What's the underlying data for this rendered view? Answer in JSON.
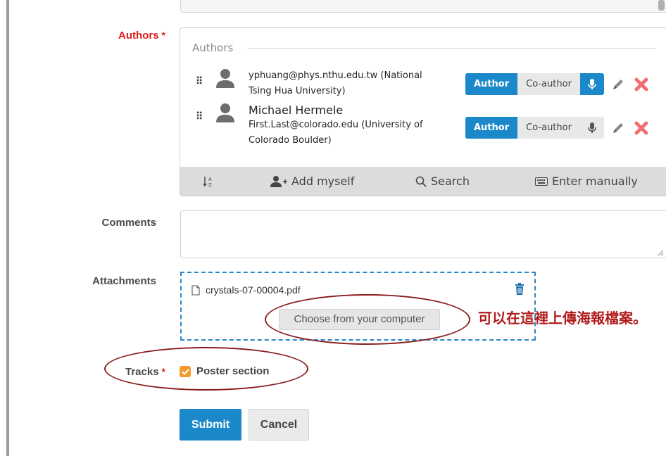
{
  "form": {
    "authors_label": "Authors",
    "comments_label": "Comments",
    "attachments_label": "Attachments",
    "tracks_label": "Tracks",
    "required_mark": "*"
  },
  "authors": {
    "legend": "Authors",
    "list": [
      {
        "name": "",
        "detail_line1": "yphuang@phys.nthu.edu.tw (National",
        "detail_line2": "Tsing Hua University)",
        "role_author": "Author",
        "role_coauthor": "Co-author",
        "speaker_active": true
      },
      {
        "name": "Michael Hermele",
        "detail_line1": "First.Last@colorado.edu (University of",
        "detail_line2": "Colorado Boulder)",
        "role_author": "Author",
        "role_coauthor": "Co-author",
        "speaker_active": false
      }
    ],
    "toolbar": {
      "sort_icon": "sort-alpha-icon",
      "add_myself": "Add myself",
      "search": "Search",
      "enter_manually": "Enter manually"
    }
  },
  "comments": {
    "value": ""
  },
  "attachments": {
    "file_name": "crystals-07-00004.pdf",
    "choose_button": "Choose from your computer"
  },
  "annotation": {
    "text": "可以在這裡上傳海報檔案。",
    "color": "#b01c1c"
  },
  "tracks": {
    "option_label": "Poster section",
    "checked": true
  },
  "buttons": {
    "submit": "Submit",
    "cancel": "Cancel"
  },
  "colors": {
    "primary": "#1a88c9",
    "required": "#e01b1b",
    "checkbox": "#f39c2d",
    "annotation_outline": "#8a1d1d"
  }
}
